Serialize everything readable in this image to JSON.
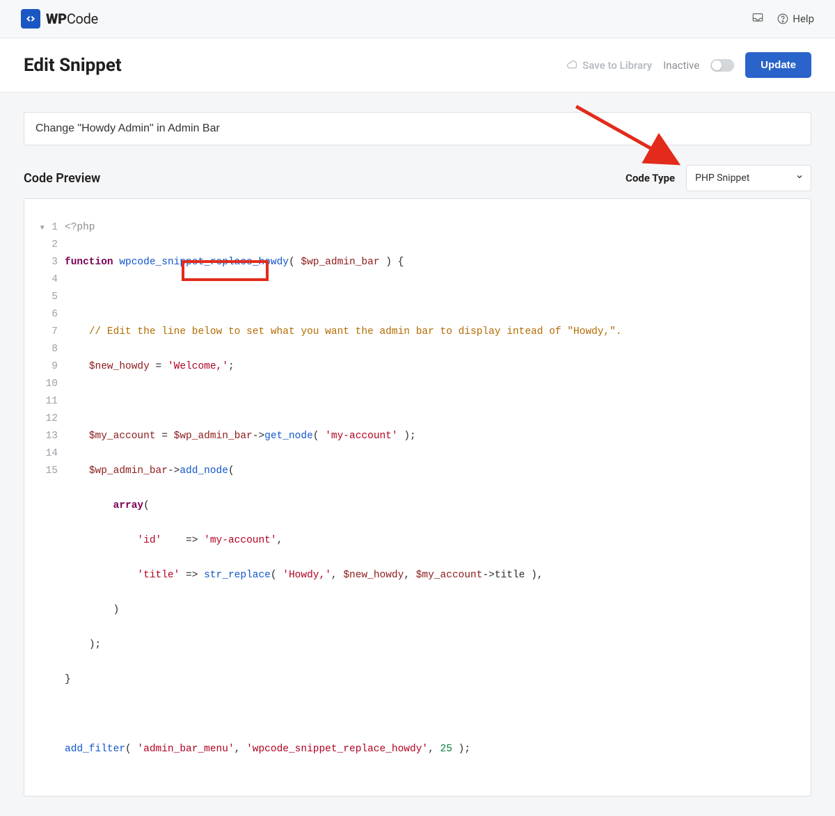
{
  "brand": {
    "name_bold": "WP",
    "name_rest": "Code"
  },
  "top": {
    "help": "Help"
  },
  "actions": {
    "page_title": "Edit Snippet",
    "save_library": "Save to Library",
    "status": "Inactive",
    "update": "Update"
  },
  "snippet_title": "Change \"Howdy Admin\" in Admin Bar",
  "preview": {
    "label": "Code Preview",
    "code_type_label": "Code Type",
    "code_type_value": "PHP Snippet"
  },
  "code": {
    "open": "<?php",
    "l1_kw": "function",
    "l1_fn": "wpcode_snippet_replace_howdy",
    "l1_var": "$wp_admin_bar",
    "l3_comment": "// Edit the line below to set what you want the admin bar to display intead of \"Howdy,\".",
    "l4_var": "$new_howdy",
    "l4_str": "'Welcome,'",
    "l6_var1": "$my_account",
    "l6_var2": "$wp_admin_bar",
    "l6_m": "get_node",
    "l6_str": "'my-account'",
    "l7_var": "$wp_admin_bar",
    "l7_m": "add_node",
    "l8_kw": "array",
    "l9_key": "'id'",
    "l9_val": "'my-account'",
    "l10_key": "'title'",
    "l10_fn": "str_replace",
    "l10_str": "'Howdy,'",
    "l10_v1": "$new_howdy",
    "l10_v2": "$my_account",
    "l10_prop": "title",
    "l15_fn": "add_filter",
    "l15_s1": "'admin_bar_menu'",
    "l15_s2": "'wpcode_snippet_replace_howdy'",
    "l15_num": "25"
  }
}
